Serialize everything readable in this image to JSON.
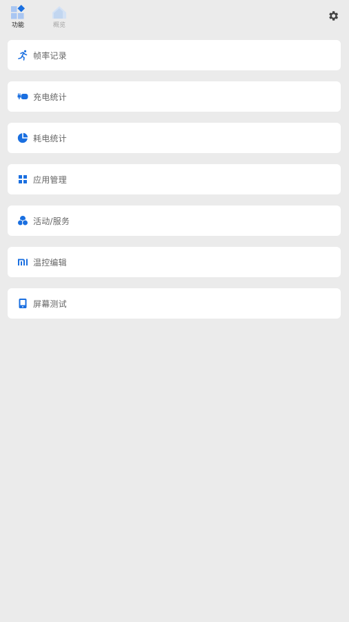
{
  "colors": {
    "accent": "#1a6fe0",
    "accent_light": "#a9c6f2",
    "background": "#ebebeb",
    "card": "#ffffff",
    "label": "#666666"
  },
  "tabs": [
    {
      "label": "功能",
      "icon": "functions-icon",
      "active": true
    },
    {
      "label": "概览",
      "icon": "overview-home-icon",
      "active": false
    }
  ],
  "settings_icon": "gear-icon",
  "menu": {
    "items": [
      {
        "label": "帧率记录",
        "icon": "running-person-icon"
      },
      {
        "label": "充电统计",
        "icon": "charging-plug-icon"
      },
      {
        "label": "耗电统计",
        "icon": "pie-chart-icon"
      },
      {
        "label": "应用管理",
        "icon": "app-grid-icon"
      },
      {
        "label": "活动/服务",
        "icon": "circles-cluster-icon"
      },
      {
        "label": "温控编辑",
        "icon": "mi-logo-icon"
      },
      {
        "label": "屏幕测试",
        "icon": "phone-screen-icon"
      }
    ]
  }
}
